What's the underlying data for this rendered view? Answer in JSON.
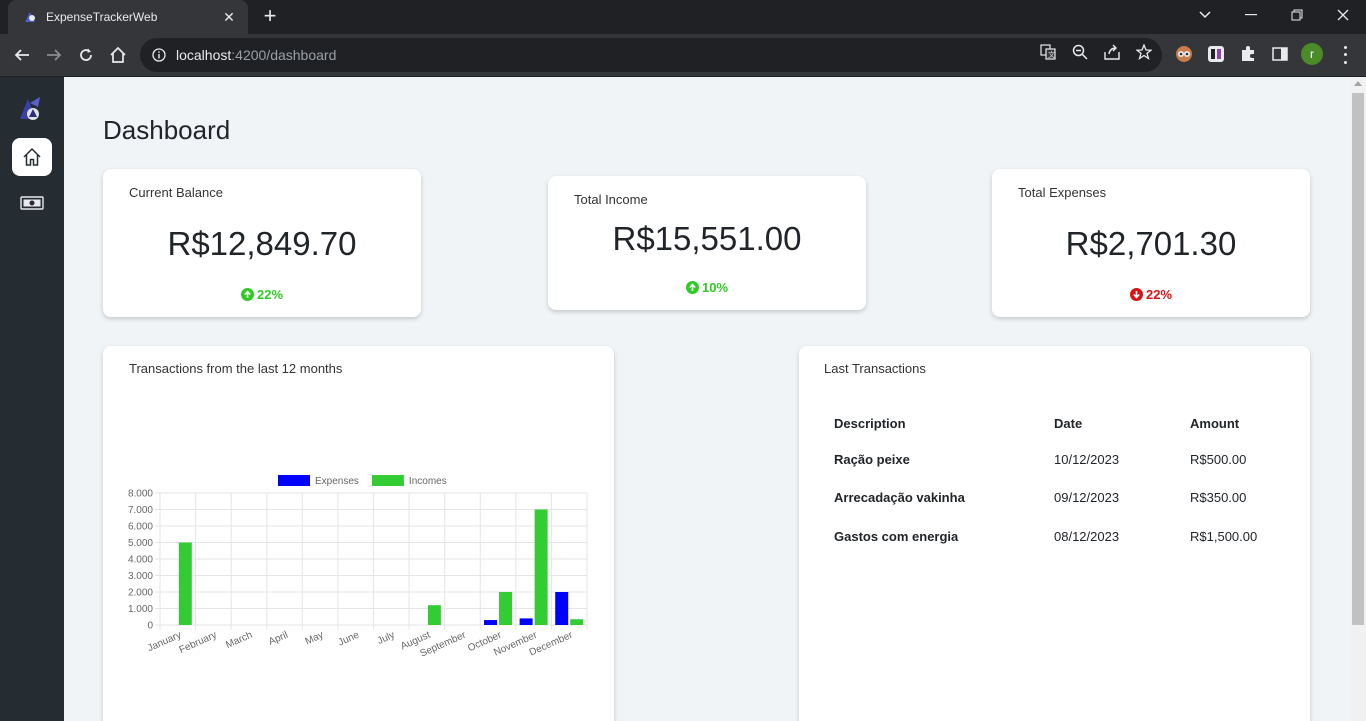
{
  "browser": {
    "tab_title": "ExpenseTrackerWeb",
    "url_host": "localhost",
    "url_path": ":4200/dashboard",
    "profile_initial": "r"
  },
  "sidebar": {
    "items": [
      {
        "name": "home",
        "icon": "home-icon",
        "active": true
      },
      {
        "name": "transactions",
        "icon": "money-icon",
        "active": false
      }
    ]
  },
  "dashboard": {
    "title": "Dashboard",
    "cards": {
      "balance": {
        "label": "Current Balance",
        "value": "R$12,849.70",
        "trend": "22%",
        "direction": "up"
      },
      "income": {
        "label": "Total Income",
        "value": "R$15,551.00",
        "trend": "10%",
        "direction": "up"
      },
      "expenses": {
        "label": "Total Expenses",
        "value": "R$2,701.30",
        "trend": "22%",
        "direction": "down"
      }
    },
    "chart_title": "Transactions from the last 12 months",
    "transactions": {
      "title": "Last Transactions",
      "headers": {
        "description": "Description",
        "date": "Date",
        "amount": "Amount"
      },
      "rows": [
        {
          "description": "Ração peixe",
          "date": "10/12/2023",
          "amount": "R$500.00",
          "type": "expense"
        },
        {
          "description": "Arrecadação vakinha",
          "date": "09/12/2023",
          "amount": "R$350.00",
          "type": "income"
        },
        {
          "description": "Gastos com energia",
          "date": "08/12/2023",
          "amount": "R$1,500.00",
          "type": "expense"
        }
      ]
    }
  },
  "colors": {
    "expenses": "#0000ff",
    "incomes": "#33cc33",
    "positive": "#2ecc23",
    "negative": "#d91313",
    "sidebar": "#252d33"
  },
  "chart_data": {
    "type": "bar",
    "title": "Transactions from the last 12 months",
    "categories": [
      "January",
      "February",
      "March",
      "April",
      "May",
      "June",
      "July",
      "August",
      "September",
      "October",
      "November",
      "December"
    ],
    "series": [
      {
        "name": "Expenses",
        "color": "#0000ff",
        "values": [
          0,
          0,
          0,
          0,
          0,
          0,
          0,
          0,
          0,
          300,
          400,
          2000
        ]
      },
      {
        "name": "Incomes",
        "color": "#33cc33",
        "values": [
          5000,
          0,
          0,
          0,
          0,
          0,
          0,
          1200,
          0,
          2000,
          7000,
          350
        ]
      }
    ],
    "y_ticks": [
      "0",
      "1.000",
      "2.000",
      "3.000",
      "4.000",
      "5.000",
      "6.000",
      "7.000",
      "8.000"
    ],
    "ylim": [
      0,
      8000
    ],
    "legend": "top",
    "grid": true
  }
}
